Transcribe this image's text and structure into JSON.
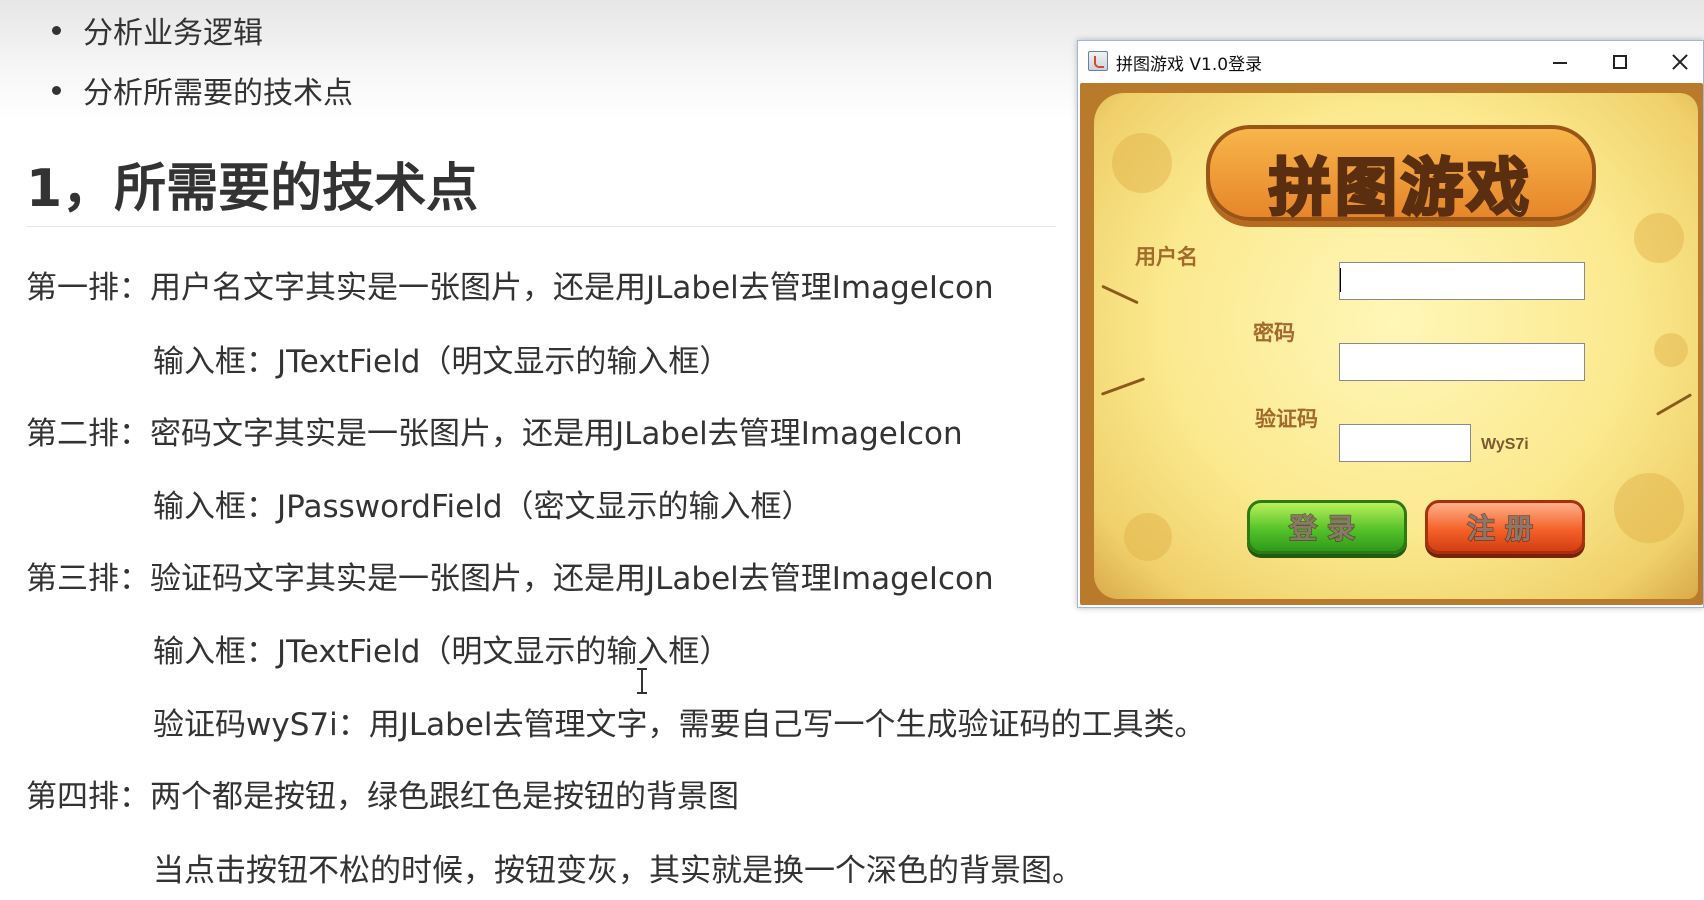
{
  "document": {
    "bullets": [
      "分析业务逻辑",
      "分析所需要的技术点"
    ],
    "heading": "1，所需要的技术点",
    "lines": [
      "第一排：用户名文字其实是一张图片，还是用JLabel去管理ImageIcon",
      "输入框：JTextField（明文显示的输入框）",
      "第二排：密码文字其实是一张图片，还是用JLabel去管理ImageIcon",
      "输入框：JPasswordField（密文显示的输入框）",
      "第三排：验证码文字其实是一张图片，还是用JLabel去管理ImageIcon",
      "输入框：JTextField（明文显示的输入框）",
      "验证码wyS7i：用JLabel去管理文字，需要自己写一个生成验证码的工具类。",
      "第四排：两个都是按钮，绿色跟红色是按钮的背景图",
      "当点击按钮不松的时候，按钮变灰，其实就是换一个深色的背景图。"
    ]
  },
  "window": {
    "title": "拼图游戏 V1.0登录",
    "controls": {
      "minimize": "minimize",
      "maximize": "maximize",
      "close": "close"
    },
    "logo": "拼图游戏",
    "labels": {
      "username": "用户名",
      "password": "密码",
      "captcha": "验证码"
    },
    "fields": {
      "username": "",
      "password": "",
      "captcha": ""
    },
    "captcha_code": "WyS7i",
    "buttons": {
      "login": "登录",
      "register": "注册"
    },
    "colors": {
      "login": "#56c22a",
      "register": "#f4622a",
      "frame": "#b97a2c",
      "parchment": "#fbe98e"
    }
  }
}
